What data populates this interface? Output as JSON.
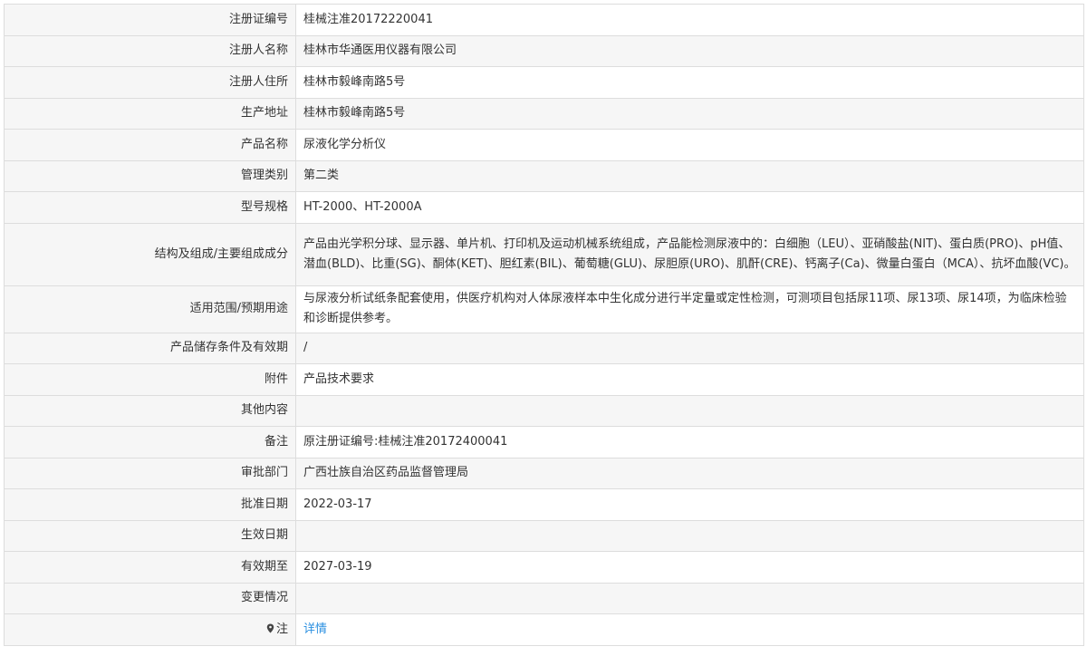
{
  "rows": [
    {
      "label": "注册证编号",
      "value": "桂械注准20172220041"
    },
    {
      "label": "注册人名称",
      "value": "桂林市华通医用仪器有限公司"
    },
    {
      "label": "注册人住所",
      "value": "桂林市毅峰南路5号"
    },
    {
      "label": "生产地址",
      "value": "桂林市毅峰南路5号"
    },
    {
      "label": "产品名称",
      "value": "尿液化学分析仪"
    },
    {
      "label": "管理类别",
      "value": "第二类"
    },
    {
      "label": "型号规格",
      "value": "HT-2000、HT-2000A"
    },
    {
      "label": "结构及组成/主要组成成分",
      "value": "产品由光学积分球、显示器、单片机、打印机及运动机械系统组成，产品能检测尿液中的：白细胞（LEU）、亚硝酸盐(NIT)、蛋白质(PRO)、pH值、潜血(BLD)、比重(SG)、酮体(KET)、胆红素(BIL)、葡萄糖(GLU)、尿胆原(URO)、肌酐(CRE)、钙离子(Ca)、微量白蛋白（MCA）、抗坏血酸(VC)。"
    },
    {
      "label": "适用范围/预期用途",
      "value": "与尿液分析试纸条配套使用，供医疗机构对人体尿液样本中生化成分进行半定量或定性检测，可测项目包括尿11项、尿13项、尿14项，为临床检验和诊断提供参考。"
    },
    {
      "label": "产品储存条件及有效期",
      "value": "/"
    },
    {
      "label": "附件",
      "value": "产品技术要求"
    },
    {
      "label": "其他内容",
      "value": ""
    },
    {
      "label": "备注",
      "value": "原注册证编号:桂械注准20172400041"
    },
    {
      "label": "审批部门",
      "value": "广西壮族自治区药品监督管理局"
    },
    {
      "label": "批准日期",
      "value": "2022-03-17"
    },
    {
      "label": "生效日期",
      "value": ""
    },
    {
      "label": "有效期至",
      "value": "2027-03-19"
    },
    {
      "label": "变更情况",
      "value": ""
    },
    {
      "label": "注",
      "value": "详情",
      "icon": "location-pin-icon"
    }
  ]
}
